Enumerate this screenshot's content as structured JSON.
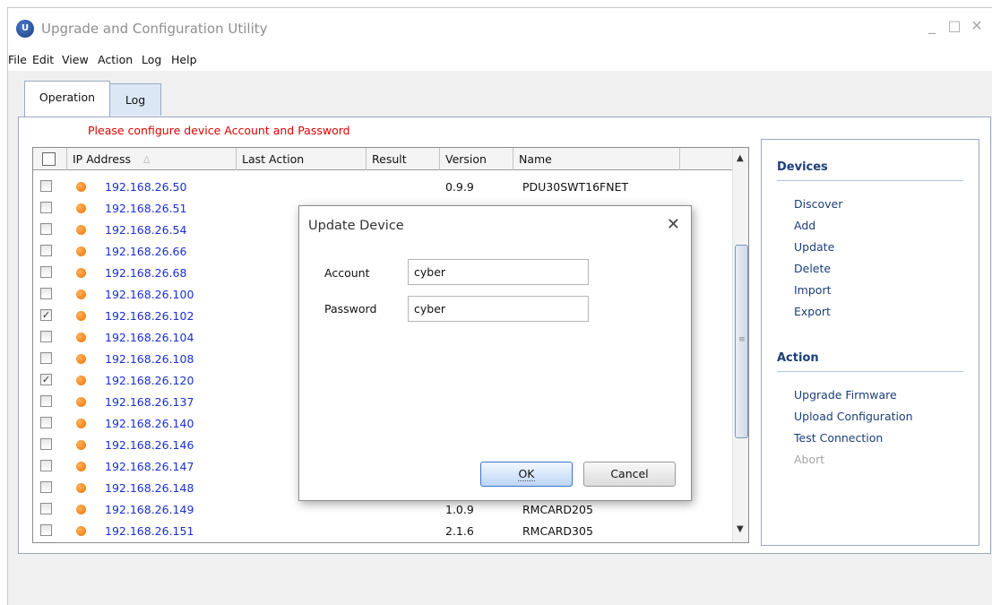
{
  "window": {
    "title": "Upgrade and Configuration Utility",
    "controls": {
      "minimize": "_",
      "maximize": "□",
      "close": "✕"
    }
  },
  "menu": [
    "File",
    "Edit",
    "View",
    "Action",
    "Log",
    "Help"
  ],
  "tabs": [
    {
      "label": "Operation",
      "active": true
    },
    {
      "label": "Log",
      "active": false
    }
  ],
  "warning": "Please configure device Account and Password",
  "grid": {
    "columns": [
      "IP Address",
      "Last Action",
      "Result",
      "Version",
      "Name"
    ],
    "sort_indicator": "∆",
    "rows": [
      {
        "checked": false,
        "ip": "192.168.26.50",
        "version": "0.9.9",
        "name": "PDU30SWT16FNET"
      },
      {
        "checked": false,
        "ip": "192.168.26.51",
        "version": "",
        "name": ""
      },
      {
        "checked": false,
        "ip": "192.168.26.54",
        "version": "",
        "name": ""
      },
      {
        "checked": false,
        "ip": "192.168.26.66",
        "version": "",
        "name": ""
      },
      {
        "checked": false,
        "ip": "192.168.26.68",
        "version": "",
        "name": ""
      },
      {
        "checked": false,
        "ip": "192.168.26.100",
        "version": "",
        "name": ""
      },
      {
        "checked": true,
        "ip": "192.168.26.102",
        "version": "",
        "name": ""
      },
      {
        "checked": false,
        "ip": "192.168.26.104",
        "version": "",
        "name": ""
      },
      {
        "checked": false,
        "ip": "192.168.26.108",
        "version": "",
        "name": ""
      },
      {
        "checked": true,
        "ip": "192.168.26.120",
        "version": "",
        "name": ""
      },
      {
        "checked": false,
        "ip": "192.168.26.137",
        "version": "",
        "name": ""
      },
      {
        "checked": false,
        "ip": "192.168.26.140",
        "version": "",
        "name": ""
      },
      {
        "checked": false,
        "ip": "192.168.26.146",
        "version": "",
        "name": ""
      },
      {
        "checked": false,
        "ip": "192.168.26.147",
        "version": "",
        "name": ""
      },
      {
        "checked": false,
        "ip": "192.168.26.148",
        "version": "",
        "name": ""
      },
      {
        "checked": false,
        "ip": "192.168.26.149",
        "version": "1.0.9",
        "name": "RMCARD205"
      },
      {
        "checked": false,
        "ip": "192.168.26.151",
        "version": "2.1.6",
        "name": "RMCARD305"
      }
    ]
  },
  "sidebar": {
    "devices_heading": "Devices",
    "devices": [
      "Discover",
      "Add",
      "Update",
      "Delete",
      "Import",
      "Export"
    ],
    "action_heading": "Action",
    "actions": [
      "Upgrade Firmware",
      "Upload Configuration",
      "Test Connection",
      "Abort"
    ]
  },
  "dialog": {
    "title": "Update Device",
    "close": "✕",
    "account_label": "Account",
    "account_value": "cyber",
    "password_label": "Password",
    "password_value": "cyber",
    "ok_label": "OK",
    "cancel_label": "Cancel"
  }
}
